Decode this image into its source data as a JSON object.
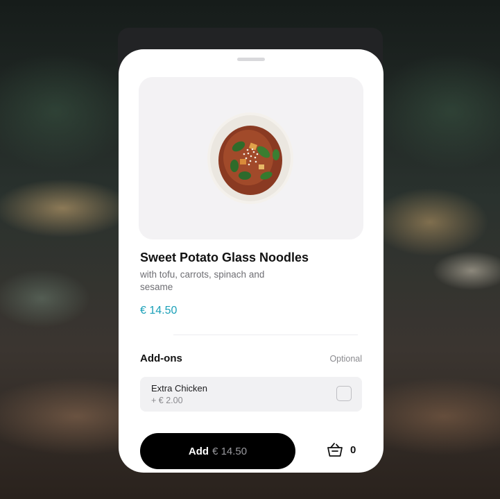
{
  "dish": {
    "name": "Sweet Potato Glass Noodles",
    "description": "with tofu, carrots, spinach and sesame",
    "price": "€ 14.50",
    "image_icon": "noodle-bowl-photo"
  },
  "addons": {
    "title": "Add-ons",
    "optional_label": "Optional",
    "items": [
      {
        "name": "Extra Chicken",
        "price": "+ € 2.00",
        "checked": false
      }
    ]
  },
  "footer": {
    "add_label": "Add",
    "add_price": "€ 14.50",
    "basket_icon": "basket-icon",
    "basket_count": "0"
  },
  "colors": {
    "price_accent": "#1aa0b8",
    "button_bg": "#000000"
  }
}
